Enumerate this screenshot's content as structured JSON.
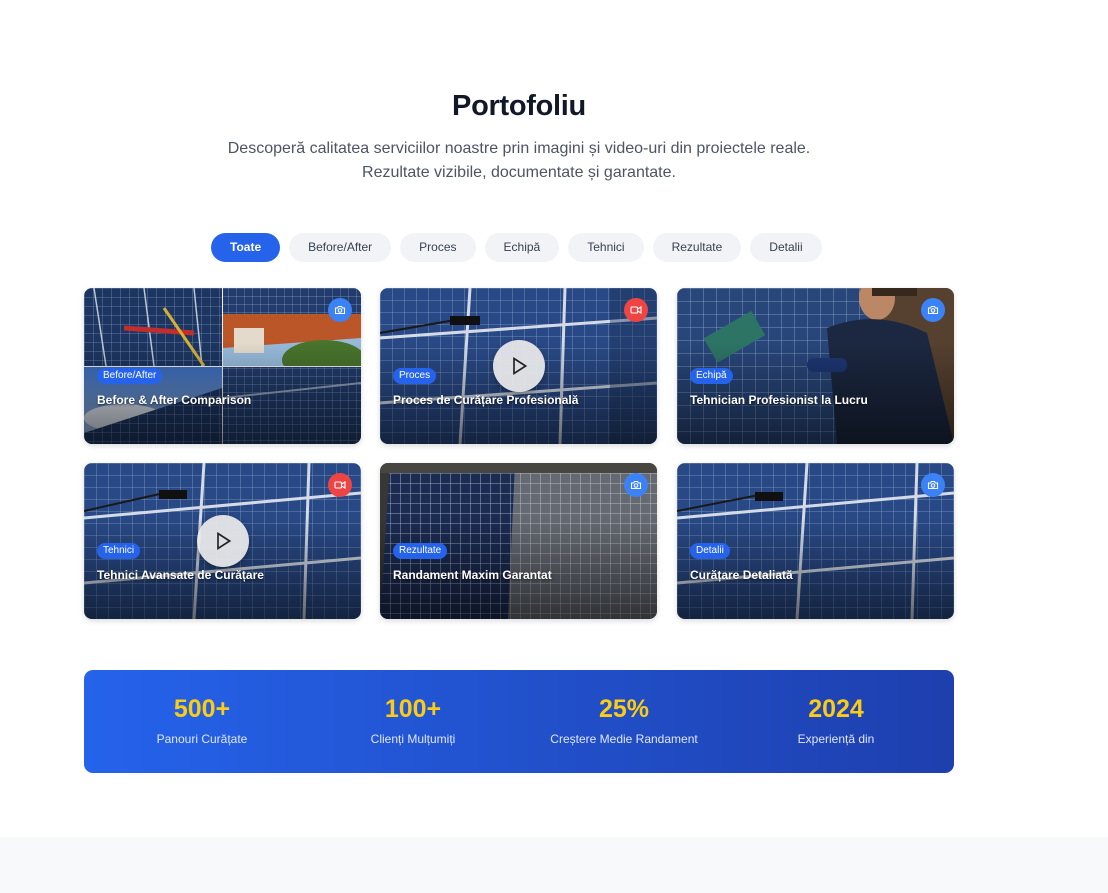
{
  "section": {
    "title": "Portofoliu",
    "subtitle": "Descoperă calitatea serviciilor noastre prin imagini și video-uri din proiectele reale. Rezultate vizibile, documentate și garantate."
  },
  "filters": [
    {
      "label": "Toate",
      "active": true
    },
    {
      "label": "Before/After"
    },
    {
      "label": "Proces"
    },
    {
      "label": "Echipă"
    },
    {
      "label": "Tehnici"
    },
    {
      "label": "Rezultate"
    },
    {
      "label": "Detalii"
    }
  ],
  "cards": [
    {
      "tag": "Before/After",
      "title": "Before & After Comparison",
      "media": "camera-icon"
    },
    {
      "tag": "Proces",
      "title": "Proces de Curățare Profesională",
      "media": "video-icon"
    },
    {
      "tag": "Echipă",
      "title": "Tehnician Profesionist la Lucru",
      "media": "camera-icon"
    },
    {
      "tag": "Tehnici",
      "title": "Tehnici Avansate de Curățare",
      "media": "video-icon"
    },
    {
      "tag": "Rezultate",
      "title": "Randament Maxim Garantat",
      "media": "camera-icon"
    },
    {
      "tag": "Detalii",
      "title": "Curățare Detaliată",
      "media": "camera-icon"
    }
  ],
  "stats": [
    {
      "value": "500+",
      "label": "Panouri Curățate"
    },
    {
      "value": "100+",
      "label": "Clienți Mulțumiți"
    },
    {
      "value": "25%",
      "label": "Creștere Medie Randament"
    },
    {
      "value": "2024",
      "label": "Experiență din"
    }
  ],
  "colors": {
    "accent": "#2563eb",
    "stat_value": "#facc15",
    "video_badge": "#ef4444",
    "photo_badge": "#3b82f6"
  }
}
